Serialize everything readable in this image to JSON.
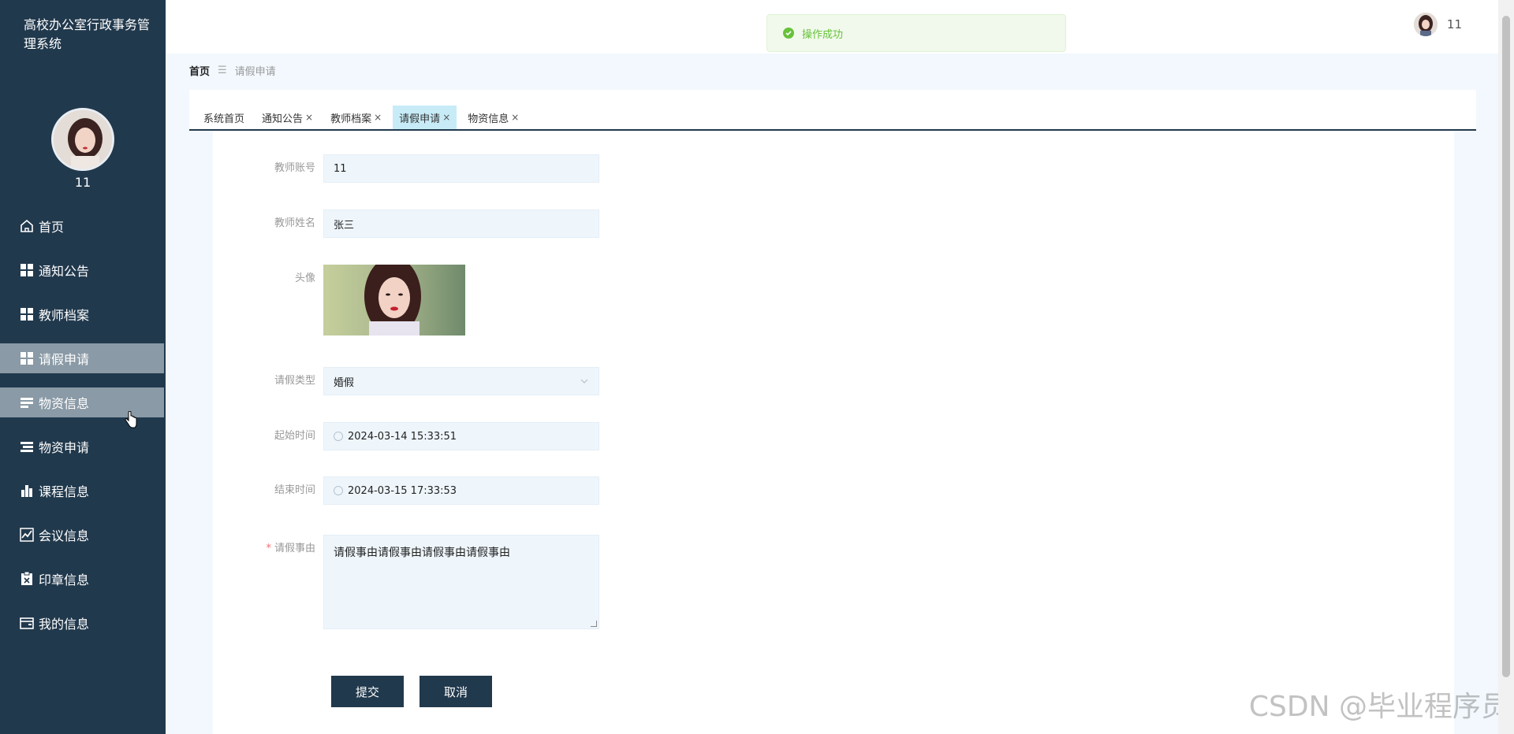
{
  "app": {
    "title": "高校办公室行政事务管理系统",
    "username": "11"
  },
  "sidebar": {
    "items": [
      {
        "label": "首页",
        "icon": "home-icon"
      },
      {
        "label": "通知公告",
        "icon": "grid-icon"
      },
      {
        "label": "教师档案",
        "icon": "grid-icon"
      },
      {
        "label": "请假申请",
        "icon": "grid-icon"
      },
      {
        "label": "物资信息",
        "icon": "list-icon"
      },
      {
        "label": "物资申请",
        "icon": "list-icon"
      },
      {
        "label": "课程信息",
        "icon": "bar-chart-icon"
      },
      {
        "label": "会议信息",
        "icon": "line-chart-icon"
      },
      {
        "label": "印章信息",
        "icon": "clipboard-x-icon"
      },
      {
        "label": "我的信息",
        "icon": "wallet-icon"
      }
    ]
  },
  "header": {
    "toast": "操作成功",
    "user": "11"
  },
  "breadcrumb": {
    "home": "首页",
    "current": "请假申请"
  },
  "tabs": [
    {
      "label": "系统首页",
      "closable": false
    },
    {
      "label": "通知公告",
      "closable": true
    },
    {
      "label": "教师档案",
      "closable": true
    },
    {
      "label": "请假申请",
      "closable": true
    },
    {
      "label": "物资信息",
      "closable": true
    }
  ],
  "tab_close_glyph": "×",
  "form": {
    "teacher_account": {
      "label": "教师账号",
      "value": "11"
    },
    "teacher_name": {
      "label": "教师姓名",
      "value": "张三"
    },
    "avatar": {
      "label": "头像"
    },
    "leave_type": {
      "label": "请假类型",
      "value": "婚假"
    },
    "start_time": {
      "label": "起始时间",
      "value": "2024-03-14 15:33:51"
    },
    "end_time": {
      "label": "结束时间",
      "value": "2024-03-15 17:33:53"
    },
    "reason": {
      "label": "请假事由",
      "required_mark": "*",
      "value": "请假事由请假事由请假事由请假事由"
    },
    "submit_label": "提交",
    "cancel_label": "取消"
  },
  "watermark": "CSDN @毕业程序员",
  "colors": {
    "sidebar_bg": "#21394d",
    "active_item": "#8a9aa6",
    "tab_active": "#c7ecf7",
    "success": "#67c23a"
  }
}
